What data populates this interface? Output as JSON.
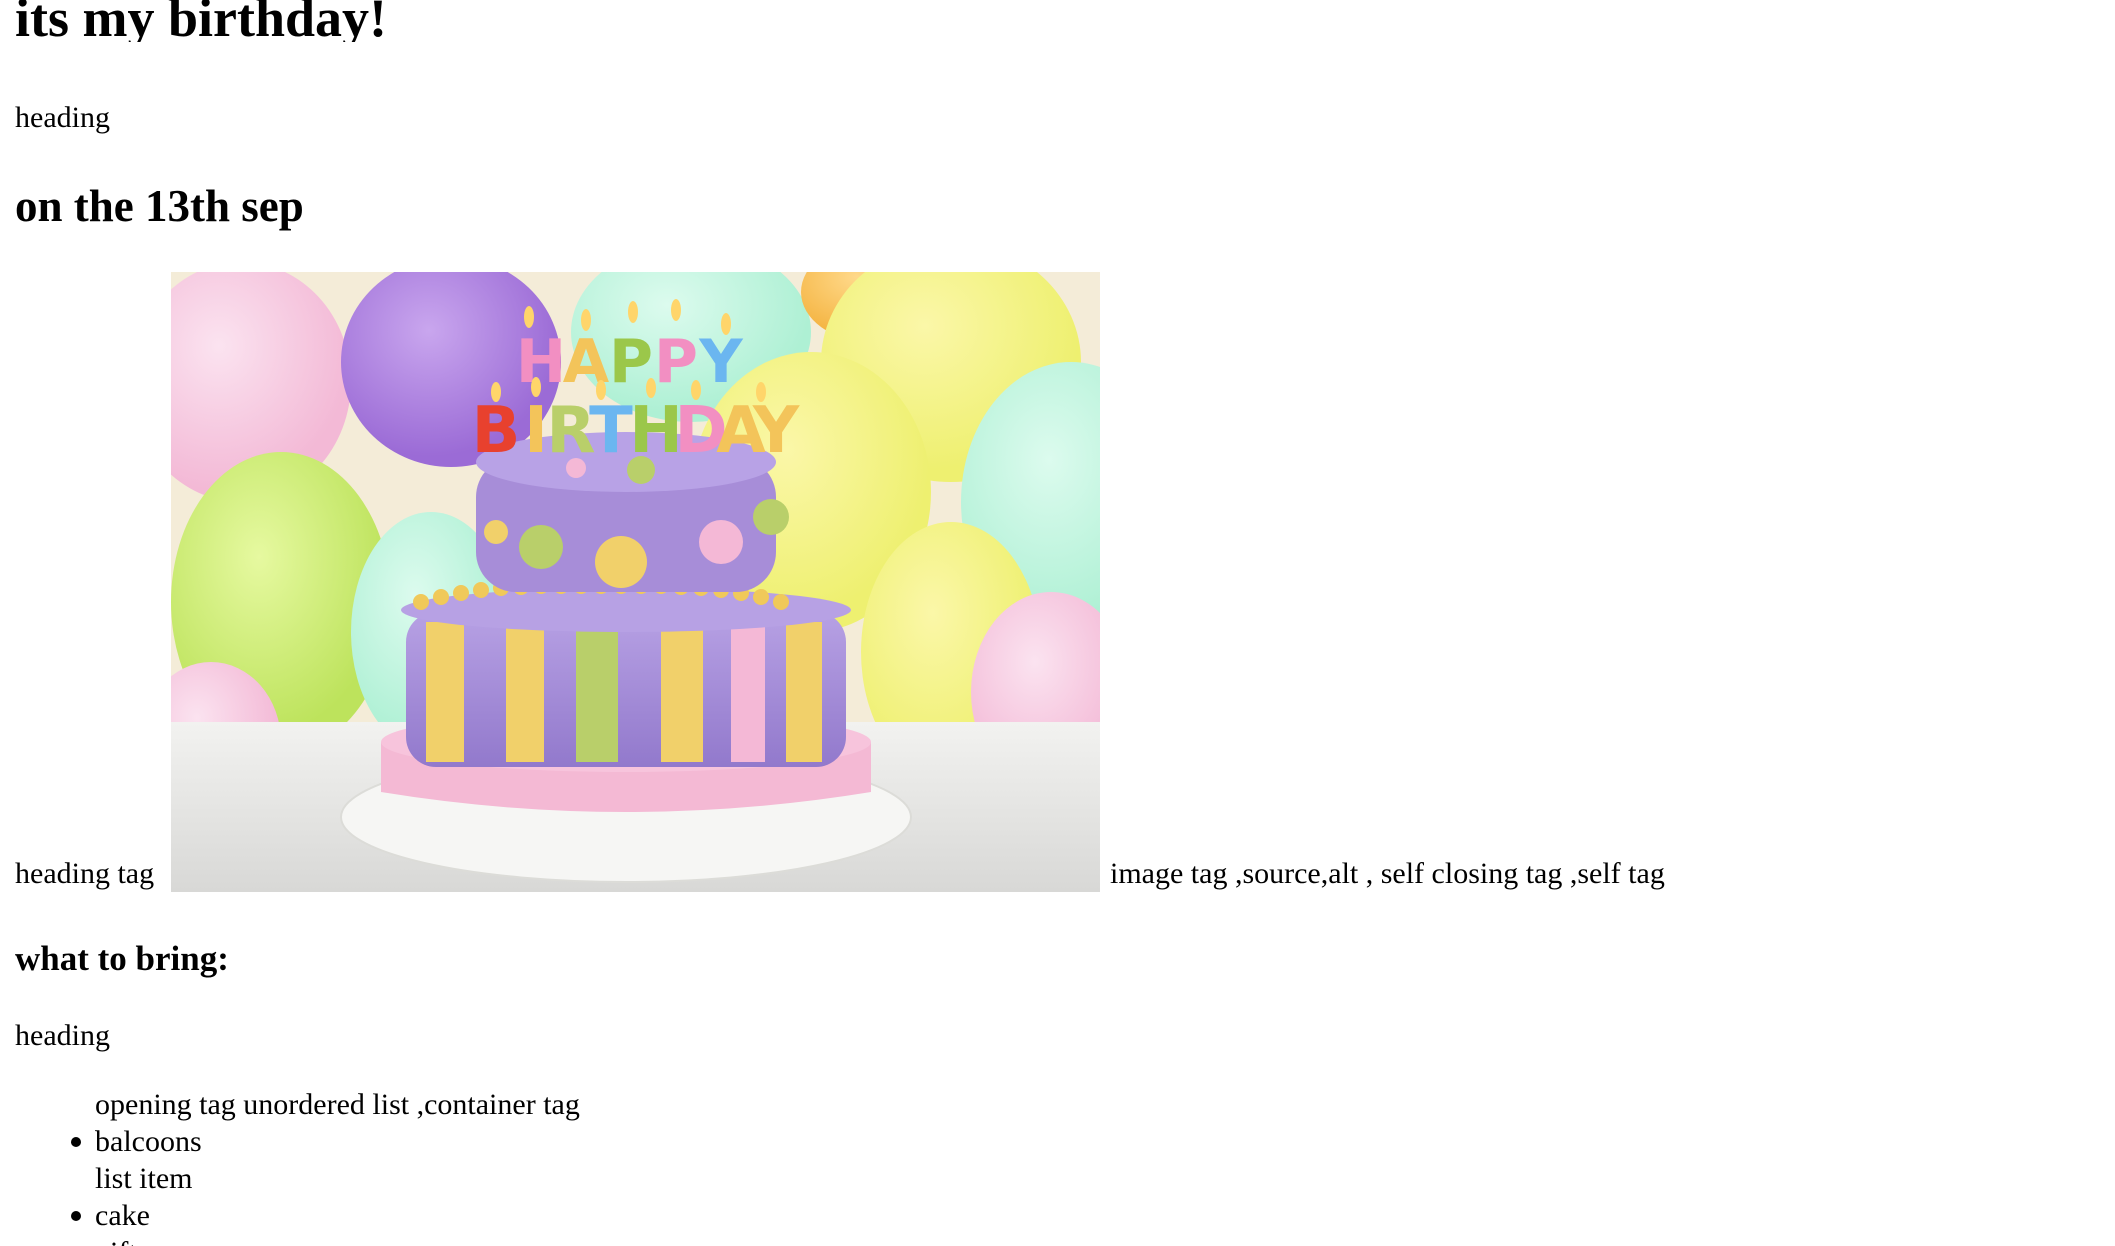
{
  "title": "its my birthday!",
  "subtitle_note": "heading",
  "date_heading": "on the 13th sep",
  "image_row": {
    "left_label": "heading tag",
    "right_label": "image tag ,source,alt , self closing tag ,self tag",
    "image_text": {
      "line1": "HAPPY",
      "line2": "BIRTHDAY"
    }
  },
  "bring_heading": "what to bring:",
  "bring_note": "heading",
  "list": {
    "intro": "opening tag unordered list ,container tag",
    "items": [
      {
        "label": "balcoons",
        "note": "list item"
      },
      {
        "label": "cake",
        "note": ""
      },
      {
        "label": "gifts",
        "note": ""
      }
    ]
  },
  "colors": {
    "text": "#000000",
    "background": "#ffffff"
  }
}
